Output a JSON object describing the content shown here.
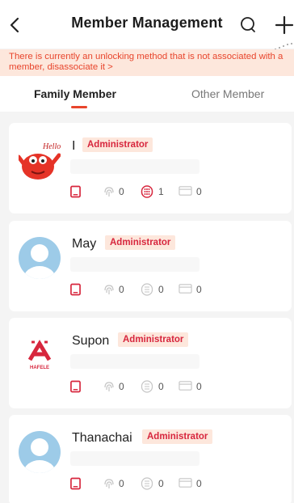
{
  "header": {
    "title": "Member Management",
    "back_icon": "chevron-left-icon",
    "search_icon": "search-icon",
    "add_icon": "plus-icon"
  },
  "banner": {
    "text": "There is currently an unlocking method that is not associated with a member, disassociate it >"
  },
  "tabs": [
    {
      "label": "Family Member",
      "active": true
    },
    {
      "label": "Other Member",
      "active": false
    }
  ],
  "colors": {
    "accent": "#e8452c",
    "badge_text": "#d7263d",
    "banner_bg": "#fde7dc",
    "avatar_blue": "#9dcbe8"
  },
  "members": [
    {
      "name": "I",
      "badge": "Administrator",
      "avatar": "cartoon-crab-hello-avatar",
      "avatar_text": "Hello",
      "stats": {
        "card": "",
        "fingerprint": "0",
        "password": "1",
        "nfc": "0"
      },
      "password_active": true
    },
    {
      "name": "May",
      "badge": "Administrator",
      "avatar": "default-person-avatar",
      "stats": {
        "card": "",
        "fingerprint": "0",
        "password": "0",
        "nfc": "0"
      },
      "password_active": false
    },
    {
      "name": "Supon",
      "badge": "Administrator",
      "avatar": "hafele-logo-avatar",
      "avatar_text": "HAFELE",
      "stats": {
        "card": "",
        "fingerprint": "0",
        "password": "0",
        "nfc": "0"
      },
      "password_active": false
    },
    {
      "name": "Thanachai",
      "badge": "Administrator",
      "avatar": "default-person-avatar",
      "stats": {
        "card": "",
        "fingerprint": "0",
        "password": "0",
        "nfc": "0"
      },
      "password_active": false
    }
  ]
}
